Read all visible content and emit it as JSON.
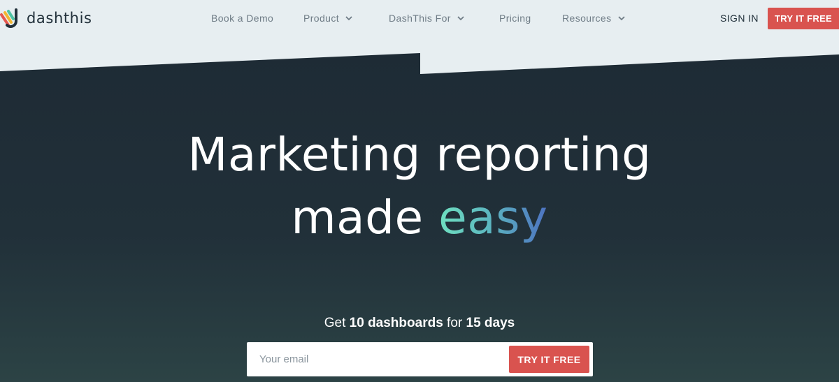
{
  "brand": {
    "name": "dashthis",
    "logo_icon": "dashthis-logo-icon"
  },
  "nav": {
    "items": [
      {
        "label": "Book a Demo",
        "has_dropdown": false
      },
      {
        "label": "Product",
        "has_dropdown": true
      },
      {
        "label": "DashThis For",
        "has_dropdown": true
      },
      {
        "label": "Pricing",
        "has_dropdown": false
      },
      {
        "label": "Resources",
        "has_dropdown": true
      }
    ],
    "sign_in": "SIGN IN",
    "cta": "TRY IT FREE"
  },
  "hero": {
    "headline_line1": "Marketing reporting",
    "headline_line2_prefix": "made",
    "headline_line2_highlight": "easy",
    "offer_prefix": "Get",
    "offer_count": "10 dashboards",
    "offer_middle": "for",
    "offer_duration": "15 days",
    "email_value": "",
    "email_placeholder": "Your email",
    "submit_label": "TRY IT FREE"
  },
  "colors": {
    "page_top": "#e7eef1",
    "hero_dark": "#1e2b35",
    "hero_bottom": "#2c4345",
    "accent_red": "#d9534f",
    "gradient_start": "#6fe0c0",
    "gradient_end": "#4d72c1",
    "nav_text": "#6f7c86"
  }
}
